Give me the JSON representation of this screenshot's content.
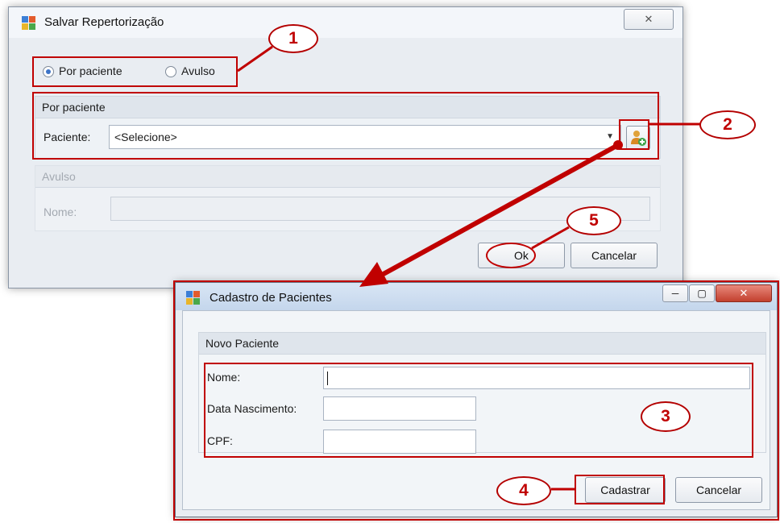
{
  "dialog1": {
    "title": "Salvar Repertorização",
    "close_glyph": "✕",
    "radio_por_paciente": "Por paciente",
    "radio_avulso": "Avulso",
    "group_por_paciente": "Por paciente",
    "paciente_label": "Paciente:",
    "paciente_value": "<Selecione>",
    "group_avulso": "Avulso",
    "nome_label": "Nome:",
    "ok": "Ok",
    "cancel": "Cancelar"
  },
  "dialog2": {
    "title": "Cadastro de Pacientes",
    "minimize_glyph": "─",
    "maximize_glyph": "▢",
    "close_glyph": "✕",
    "group_title": "Novo Paciente",
    "nome_label": "Nome:",
    "data_label": "Data Nascimento:",
    "cpf_label": "CPF:",
    "register": "Cadastrar",
    "cancel": "Cancelar"
  },
  "callouts": {
    "c1": "1",
    "c2": "2",
    "c3": "3",
    "c4": "4",
    "c5": "5"
  },
  "icons": {
    "app": "window-app-icon",
    "add_patient": "add-user-icon",
    "dropdown": "chevron-down-icon"
  },
  "colors": {
    "annotation": "#c00000",
    "radio_selected": "#3d74c7"
  }
}
